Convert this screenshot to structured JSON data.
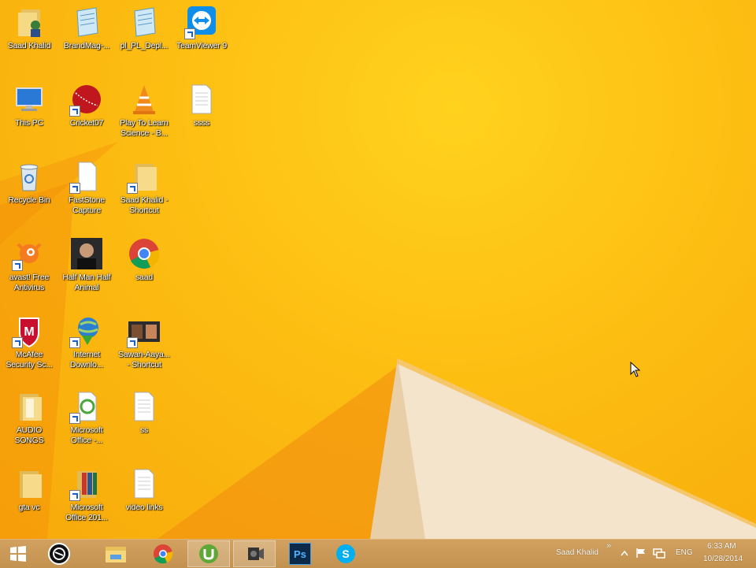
{
  "desktop_icons": [
    {
      "label": "Saad Khalid",
      "icon": "user-folder-icon"
    },
    {
      "label": "BrandMag-...",
      "icon": "notepad-icon"
    },
    {
      "label": "pl_PL_Depl...",
      "icon": "notepad-icon"
    },
    {
      "label": "TeamViewer 9",
      "icon": "teamviewer-icon"
    },
    {
      "label": "This PC",
      "icon": "computer-icon"
    },
    {
      "label": "Cricket07",
      "icon": "cricket-ball-icon"
    },
    {
      "label": "Play To Learn\nScience - B...",
      "icon": "vlc-icon"
    },
    {
      "label": "ssss",
      "icon": "text-file-icon"
    },
    {
      "label": "Recycle Bin",
      "icon": "recycle-bin-icon"
    },
    {
      "label": "FastStone\nCapture",
      "icon": "document-icon"
    },
    {
      "label": "Saad Khalid -\nShortcut",
      "icon": "folder-icon"
    },
    {
      "label": "avast! Free\nAntivirus",
      "icon": "avast-icon"
    },
    {
      "label": "Half Man Half\nAnimal",
      "icon": "photo-icon"
    },
    {
      "label": "saad",
      "icon": "chrome-icon"
    },
    {
      "label": "McAfee\nSecurity Sc...",
      "icon": "mcafee-icon"
    },
    {
      "label": "Internet\nDownlo...",
      "icon": "globe-download-icon"
    },
    {
      "label": "Sawan-Aaya...\n- Shortcut",
      "icon": "video-thumbnail-icon"
    },
    {
      "label": "AUDIO\nSONGS",
      "icon": "folder-icon"
    },
    {
      "label": "Microsoft\nOffice -...",
      "icon": "office-icon"
    },
    {
      "label": "ss",
      "icon": "text-file-icon"
    },
    {
      "label": "gta vc",
      "icon": "folder-icon"
    },
    {
      "label": "Microsoft\nOffice 201...",
      "icon": "office-folder-icon"
    },
    {
      "label": "video links",
      "icon": "text-file-icon"
    }
  ],
  "taskbar": {
    "buttons": [
      "windows-start-icon",
      "cortana-circle-icon",
      "file-explorer-icon",
      "chrome-icon",
      "utorrent-icon",
      "camera-icon",
      "photoshop-icon",
      "skype-icon"
    ],
    "photoshop_label": "Ps",
    "user": "Saad Khalid",
    "chevron": "»",
    "lang": "ENG",
    "time": "6:33 AM",
    "date": "10/28/2014"
  },
  "colors": {
    "accent": "#fdbe12",
    "taskbar": "#c8965a"
  }
}
